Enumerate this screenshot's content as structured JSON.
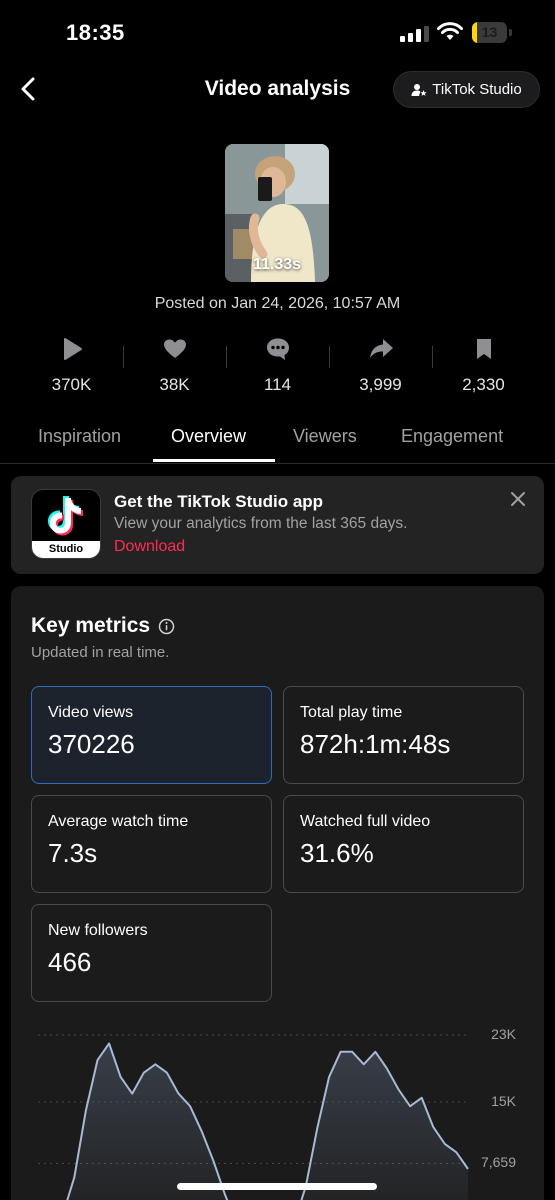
{
  "status_bar": {
    "time": "18:35",
    "battery_level": "13",
    "battery_fraction": 0.13,
    "battery_color": "#ffd60a"
  },
  "nav": {
    "back_icon": "chevron-left-icon",
    "title": "Video analysis",
    "studio_button": "TikTok Studio",
    "studio_icon": "person-star-icon"
  },
  "video": {
    "duration": "11.33s",
    "posted": "Posted on Jan 24, 2026, 10:57 AM",
    "stats": [
      {
        "icon": "play-icon",
        "value": "370K"
      },
      {
        "icon": "heart-icon",
        "value": "38K"
      },
      {
        "icon": "comment-icon",
        "value": "114"
      },
      {
        "icon": "share-icon",
        "value": "3,999"
      },
      {
        "icon": "bookmark-icon",
        "value": "2,330"
      }
    ]
  },
  "tabs": [
    {
      "label": "Inspiration",
      "active": false
    },
    {
      "label": "Overview",
      "active": true
    },
    {
      "label": "Viewers",
      "active": false
    },
    {
      "label": "Engagement",
      "active": false
    }
  ],
  "promo": {
    "logo_label": "Studio",
    "title": "Get the TikTok Studio app",
    "subtitle": "View your analytics from the last 365 days.",
    "link": "Download",
    "link_color": "#fe2c55"
  },
  "metrics": {
    "title": "Key metrics",
    "subtitle": "Updated in real time.",
    "cards": [
      {
        "label": "Video views",
        "value": "370226",
        "selected": true
      },
      {
        "label": "Total play time",
        "value": "872h:1m:48s",
        "selected": false
      },
      {
        "label": "Average watch time",
        "value": "7.3s",
        "selected": false
      },
      {
        "label": "Watched full video",
        "value": "31.6%",
        "selected": false
      },
      {
        "label": "New followers",
        "value": "466",
        "selected": false
      }
    ],
    "selected_color": "#2f6cb8"
  },
  "chart_data": {
    "type": "area",
    "y_ticks": [
      "23K",
      "15K",
      "7,659"
    ],
    "y_tick_values": [
      23000,
      15000,
      7659
    ],
    "series": [
      {
        "values": [
          0,
          0,
          0,
          1500,
          6000,
          14000,
          20000,
          22000,
          18000,
          16000,
          18500,
          19500,
          18500,
          16000,
          14500,
          11500,
          8000,
          4000,
          500,
          0,
          0,
          0,
          0,
          500,
          5000,
          12000,
          18000,
          21000,
          21000,
          19500,
          21000,
          19000,
          16500,
          14500,
          15500,
          12000,
          10000,
          9000,
          7000
        ]
      }
    ],
    "grid": true,
    "legend": "none"
  }
}
